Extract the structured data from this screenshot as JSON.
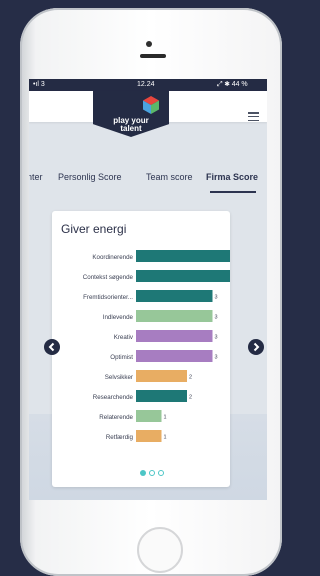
{
  "status_bar": {
    "signal": "•ıl 3",
    "time": "12.24",
    "battery": "⤢ ✱ 44 %"
  },
  "app": {
    "logo_line1": "play your",
    "logo_line2": "talent"
  },
  "tabs": [
    {
      "label": "nter",
      "active": false
    },
    {
      "label": "Personlig Score",
      "active": false
    },
    {
      "label": "Team score",
      "active": false
    },
    {
      "label": "Firma Score",
      "active": true
    }
  ],
  "card": {
    "title": "Giver energi"
  },
  "chart_data": {
    "type": "bar",
    "orientation": "horizontal",
    "title": "Giver energi",
    "categories": [
      "Koordinerende",
      "Contekst søgende",
      "Fremtidsorienter...",
      "Indlevende",
      "Kreativ",
      "Optimist",
      "Selvsikker",
      "Researchende",
      "Relaterende",
      "Retfærdig"
    ],
    "values": [
      4,
      4,
      3,
      3,
      3,
      3,
      2,
      2,
      1,
      1
    ],
    "colors": [
      "#1e7876",
      "#1e7876",
      "#1e7876",
      "#97c799",
      "#a77dc1",
      "#a77dc1",
      "#e8ad63",
      "#1e7876",
      "#97c799",
      "#e8ad63"
    ],
    "xlim": [
      0,
      4
    ]
  },
  "pagination": {
    "count": 3,
    "active_index": 0,
    "color": "#4dc6c6"
  },
  "colors": {
    "navy": "#242b44",
    "teal": "#1e7876",
    "green": "#97c799",
    "purple": "#a77dc1",
    "orange": "#e8ad63"
  }
}
